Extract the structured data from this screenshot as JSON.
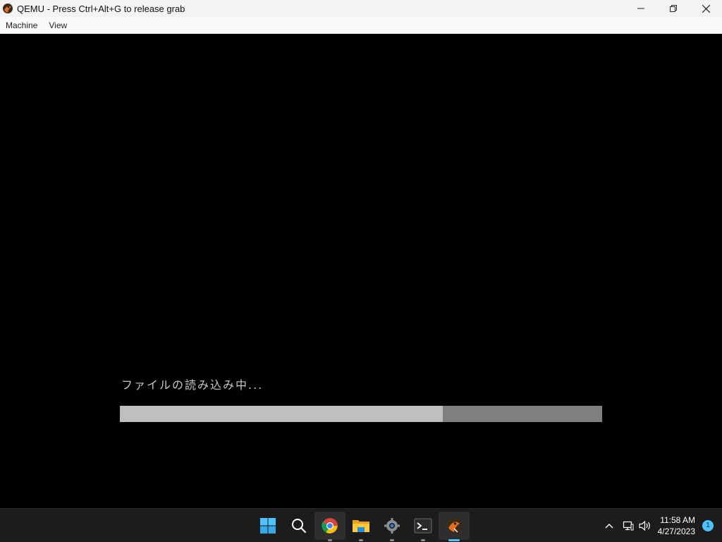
{
  "window": {
    "title": "QEMU - Press Ctrl+Alt+G to release grab",
    "controls": [
      "minimize",
      "restore",
      "close"
    ]
  },
  "menu": {
    "items": [
      {
        "label": "Machine"
      },
      {
        "label": "View"
      }
    ]
  },
  "vm_screen": {
    "loading_text": "ファイルの読み込み中...",
    "progress_percent": 67,
    "colors": {
      "fill": "#bfbfbf",
      "track": "#7f7f7f",
      "text": "#c8c8c8"
    }
  },
  "taskbar": {
    "apps": [
      {
        "name": "start-icon"
      },
      {
        "name": "search-icon"
      },
      {
        "name": "chrome-icon",
        "running": true,
        "active": true
      },
      {
        "name": "file-explorer-icon",
        "running": true
      },
      {
        "name": "settings-icon",
        "running": true
      },
      {
        "name": "terminal-icon",
        "running": true
      },
      {
        "name": "qemu-icon",
        "running": true,
        "focused": true
      }
    ],
    "tray": {
      "time": "11:58 AM",
      "date": "4/27/2023",
      "notification_count": "1"
    },
    "accent_color": "#4cc2ff"
  }
}
